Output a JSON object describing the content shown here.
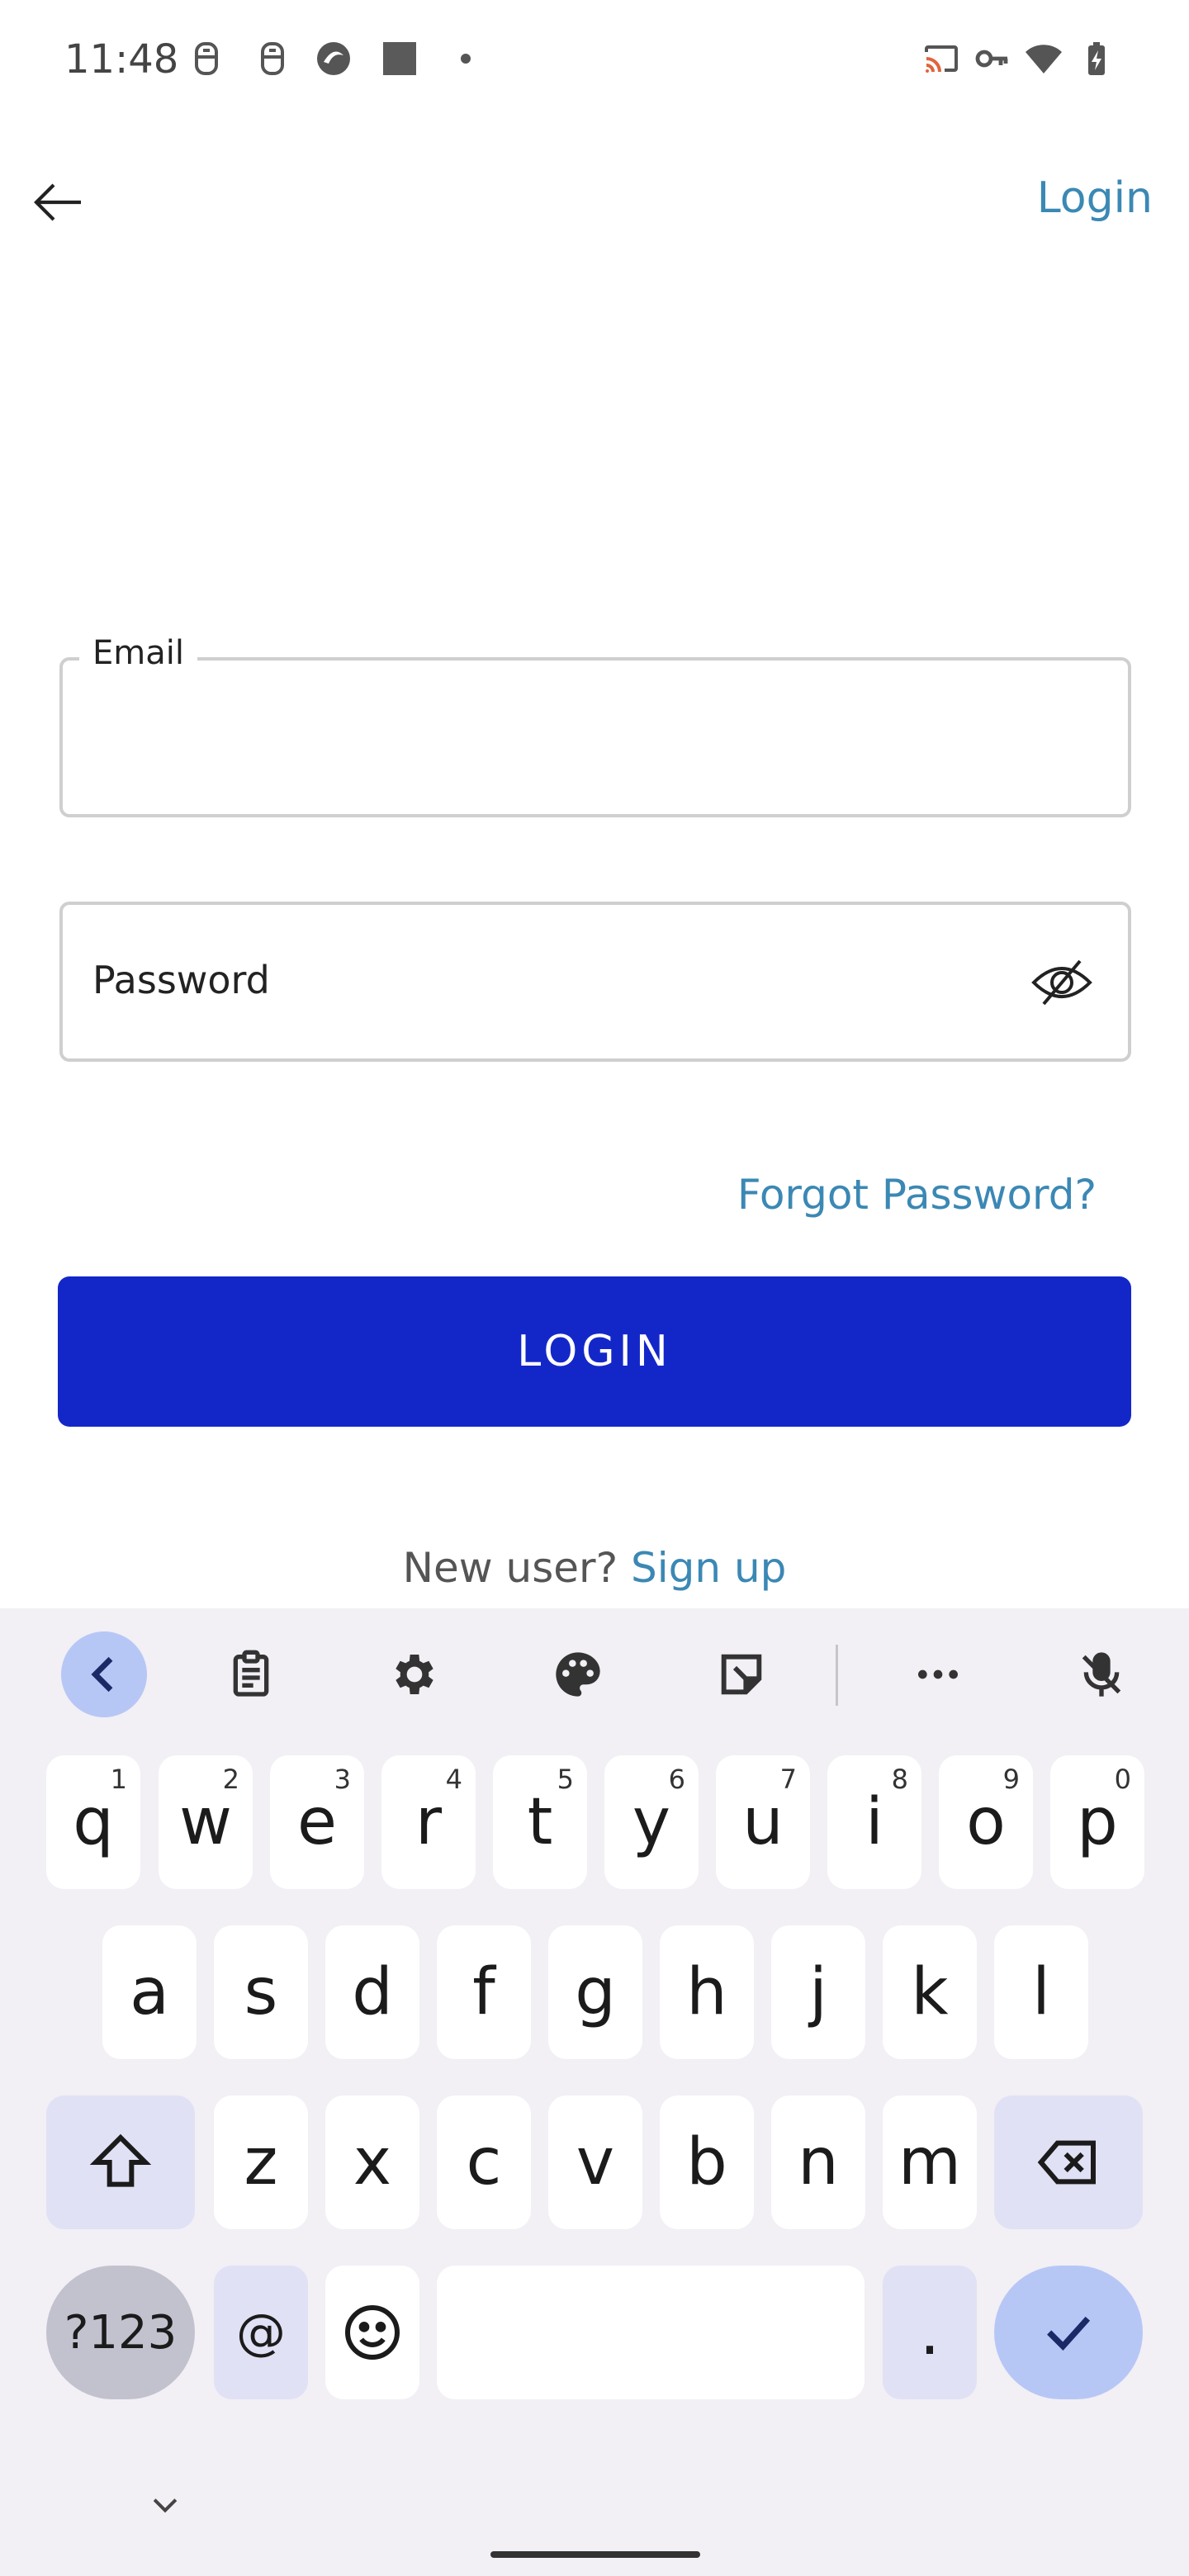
{
  "status_bar": {
    "time": "11:48",
    "left_icons": [
      "notification-icon",
      "notification-icon",
      "app-icon",
      "app-icon",
      "dot-icon"
    ],
    "right_icons": [
      "cast-icon",
      "vpn-key-icon",
      "wifi-icon",
      "battery-charging-icon"
    ]
  },
  "app_bar": {
    "back_icon": "arrow-left-icon",
    "title": "Login"
  },
  "form": {
    "email_label": "Email",
    "email_value": "",
    "password_placeholder": "Password",
    "visibility_icon": "eye-off-icon",
    "forgot_password": "Forgot Password?",
    "login_button": "LOGIN",
    "signup_prefix": "New user?",
    "signup_link": "Sign up"
  },
  "colors": {
    "primary_button": "#1327c9",
    "link": "#3b88b4",
    "keyboard_bg": "#f2eff5"
  },
  "keyboard": {
    "toolbar": [
      "chevron-left-icon",
      "clipboard-icon",
      "gear-icon",
      "palette-icon",
      "sticker-icon",
      "more-horizontal-icon",
      "mic-off-icon"
    ],
    "row1": [
      {
        "key": "q",
        "hint": "1"
      },
      {
        "key": "w",
        "hint": "2"
      },
      {
        "key": "e",
        "hint": "3"
      },
      {
        "key": "r",
        "hint": "4"
      },
      {
        "key": "t",
        "hint": "5"
      },
      {
        "key": "y",
        "hint": "6"
      },
      {
        "key": "u",
        "hint": "7"
      },
      {
        "key": "i",
        "hint": "8"
      },
      {
        "key": "o",
        "hint": "9"
      },
      {
        "key": "p",
        "hint": "0"
      }
    ],
    "row2": [
      "a",
      "s",
      "d",
      "f",
      "g",
      "h",
      "j",
      "k",
      "l"
    ],
    "row3": [
      "z",
      "x",
      "c",
      "v",
      "b",
      "n",
      "m"
    ],
    "symbols": "?123",
    "at": "@",
    "period": ".",
    "space": ""
  }
}
